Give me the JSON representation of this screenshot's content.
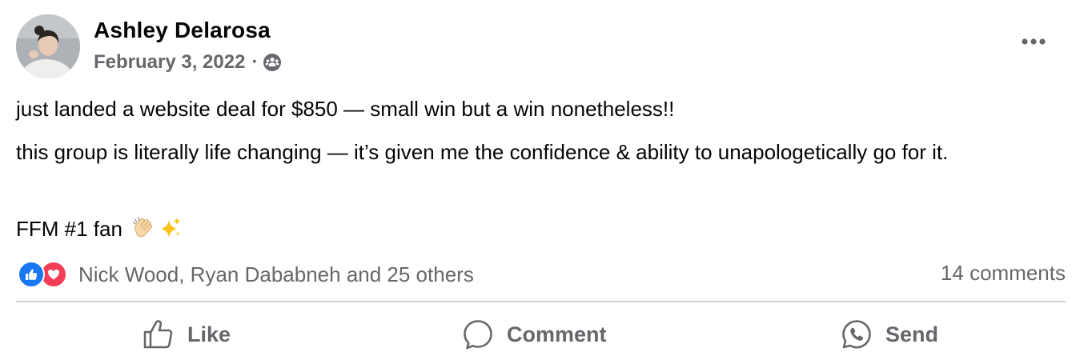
{
  "post": {
    "author": "Ashley Delarosa",
    "date": "February 3, 2022",
    "separator": "·",
    "audience_icon": "group-icon",
    "more_icon": "more-options-icon",
    "body": {
      "line1": "just landed a website deal for $850 — small win but a win nonetheless!!",
      "line2": "this group is literally life changing — it’s given me the confidence & ability to unapologetically go for it.",
      "line3": "FFM #1 fan",
      "emojis": [
        "clapping-hands-icon",
        "sparkles-icon"
      ]
    },
    "reactions": {
      "types": [
        "like-reaction-icon",
        "love-reaction-icon"
      ],
      "summary": "Nick Wood, Ryan Dababneh and 25 others"
    },
    "comments_count": "14 comments",
    "actions": {
      "like": "Like",
      "comment": "Comment",
      "send": "Send"
    }
  },
  "colors": {
    "text_primary": "#050505",
    "text_secondary": "#65676b",
    "like_blue": "#1877f2",
    "love_red": "#f33e58",
    "divider": "#ced0d4"
  }
}
